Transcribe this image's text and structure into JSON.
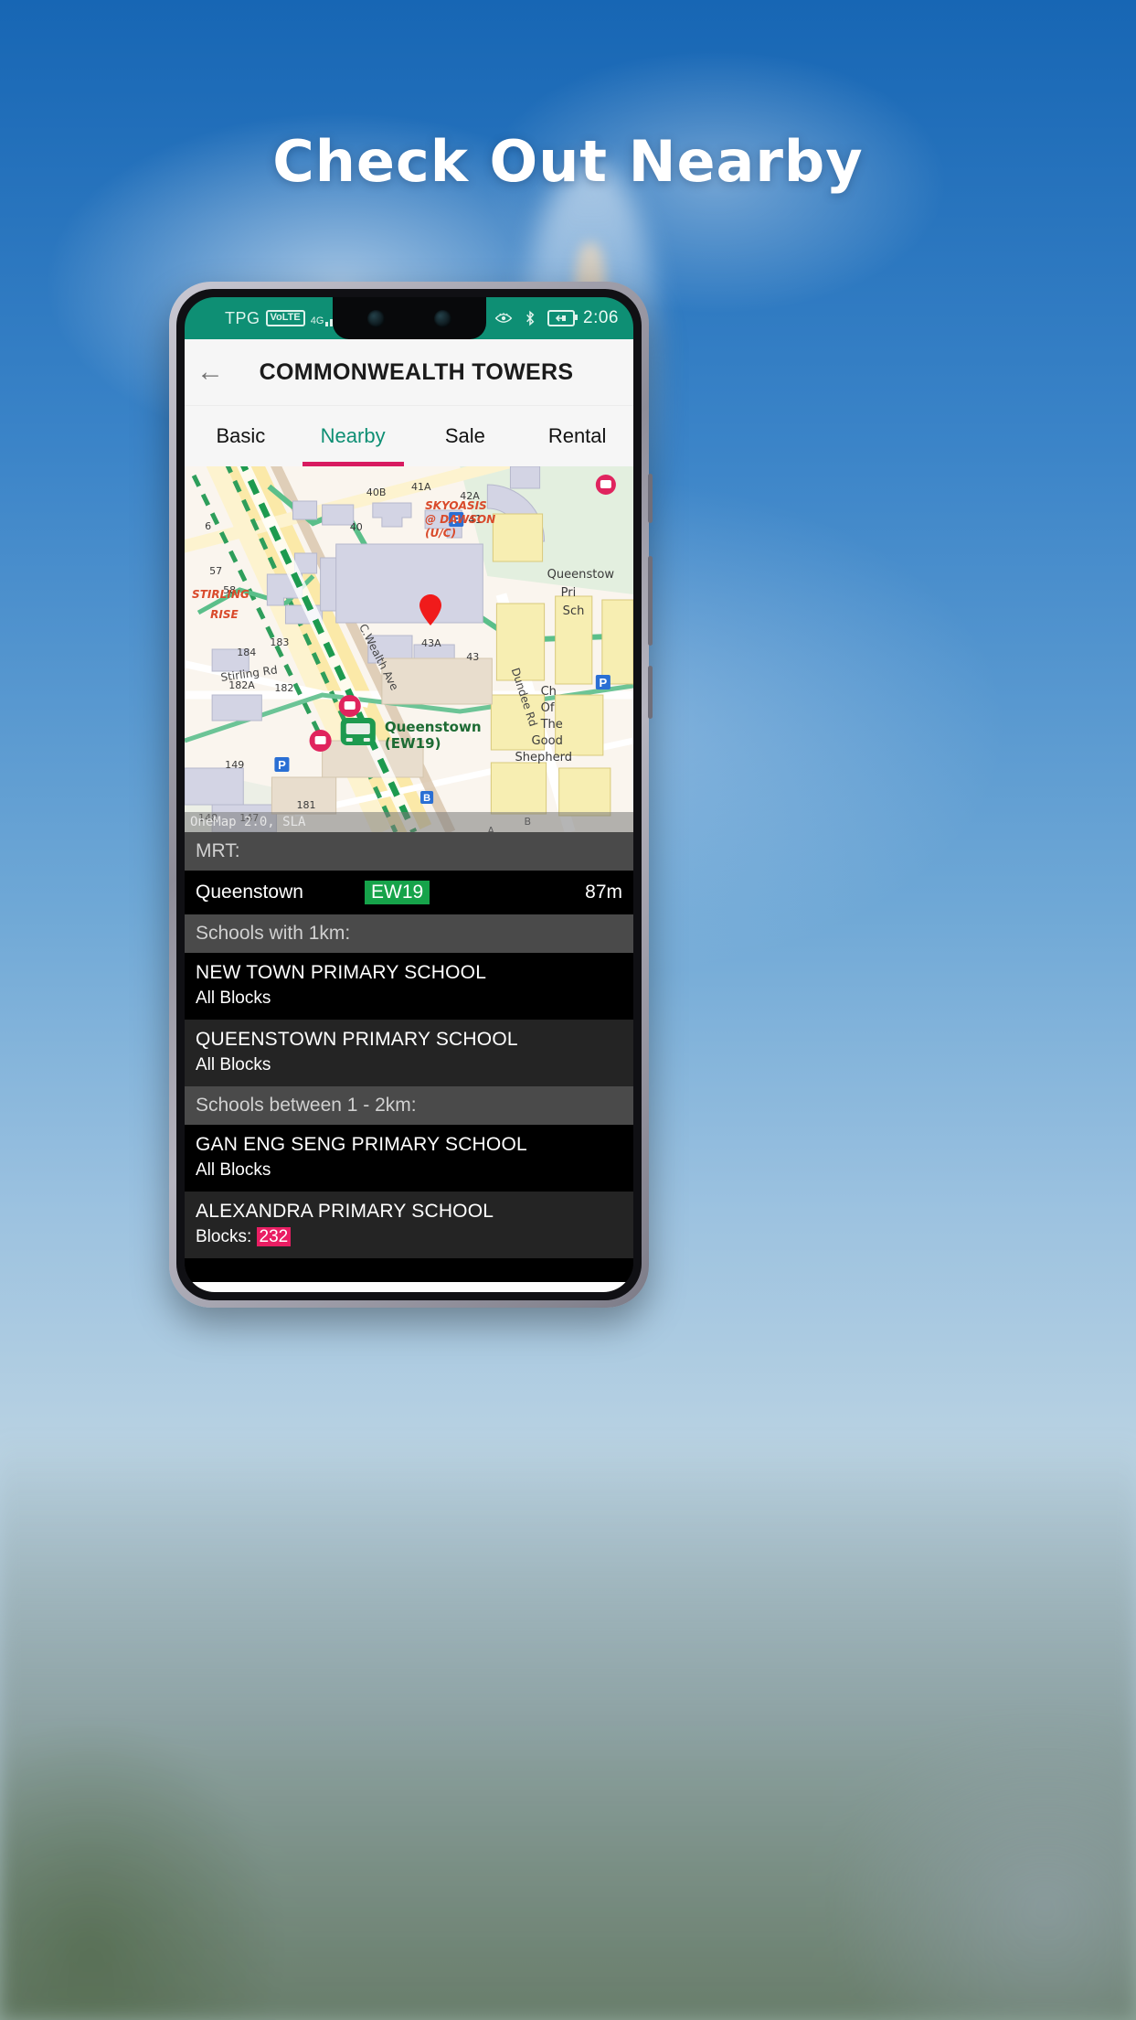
{
  "promo": {
    "headline": "Check Out Nearby"
  },
  "statusbar": {
    "carrier": "TPG",
    "volte": "VoLTE",
    "network": "4G",
    "icons_left": [
      "usb-icon",
      "gmail-icon",
      "app-icon"
    ],
    "icons_right": [
      "eye-icon",
      "bluetooth-icon",
      "battery-charging-icon"
    ],
    "clock": "2:06"
  },
  "appbar": {
    "back": "←",
    "title": "COMMONWEALTH TOWERS"
  },
  "tabs": [
    {
      "label": "Basic",
      "active": false
    },
    {
      "label": "Nearby",
      "active": true
    },
    {
      "label": "Sale",
      "active": false
    },
    {
      "label": "Rental",
      "active": false
    }
  ],
  "map": {
    "attribution": "OneMap 2.0, SLA",
    "station_label_line1": "Queenstown",
    "station_label_line2": "(EW19)",
    "labels": [
      "41A",
      "42A",
      "40B",
      "40",
      "41",
      "43A",
      "43",
      "SKYOASIS",
      "@ DAWSON",
      "(U/C)",
      "Queenstow",
      "Pri",
      "Sch",
      "57",
      "58",
      "6",
      "STIRLING",
      "RISE",
      "184",
      "183",
      "182A",
      "182",
      "Stirling Rd",
      "149",
      "148",
      "147",
      "181",
      "C.Wealth Ave",
      "Dundee Rd",
      "Ch",
      "Of",
      "The",
      "Good",
      "Shepherd",
      "A",
      "B"
    ]
  },
  "sections": [
    {
      "title": "MRT:",
      "type": "mrt",
      "rows": [
        {
          "name": "Queenstown",
          "code": "EW19",
          "distance": "87m"
        }
      ]
    },
    {
      "title": "Schools with 1km:",
      "type": "schools",
      "rows": [
        {
          "name": "NEW TOWN PRIMARY SCHOOL",
          "blocks_label": "All Blocks",
          "blocks_value": ""
        },
        {
          "name": "QUEENSTOWN PRIMARY SCHOOL",
          "blocks_label": "All Blocks",
          "blocks_value": ""
        }
      ]
    },
    {
      "title": "Schools between 1 - 2km:",
      "type": "schools",
      "rows": [
        {
          "name": "GAN ENG SENG PRIMARY SCHOOL",
          "blocks_label": "All Blocks",
          "blocks_value": ""
        },
        {
          "name": "ALEXANDRA PRIMARY SCHOOL",
          "blocks_label": "Blocks: ",
          "blocks_value": "232"
        }
      ]
    }
  ],
  "navbar": {
    "back": "back-triangle-icon",
    "home": "home-circle-icon",
    "recents": "recents-square-icon"
  },
  "colors": {
    "accent_teal": "#0e8f74",
    "accent_pink": "#d81b60",
    "badge_green": "#16a34a",
    "badge_pink": "#e91e63"
  }
}
